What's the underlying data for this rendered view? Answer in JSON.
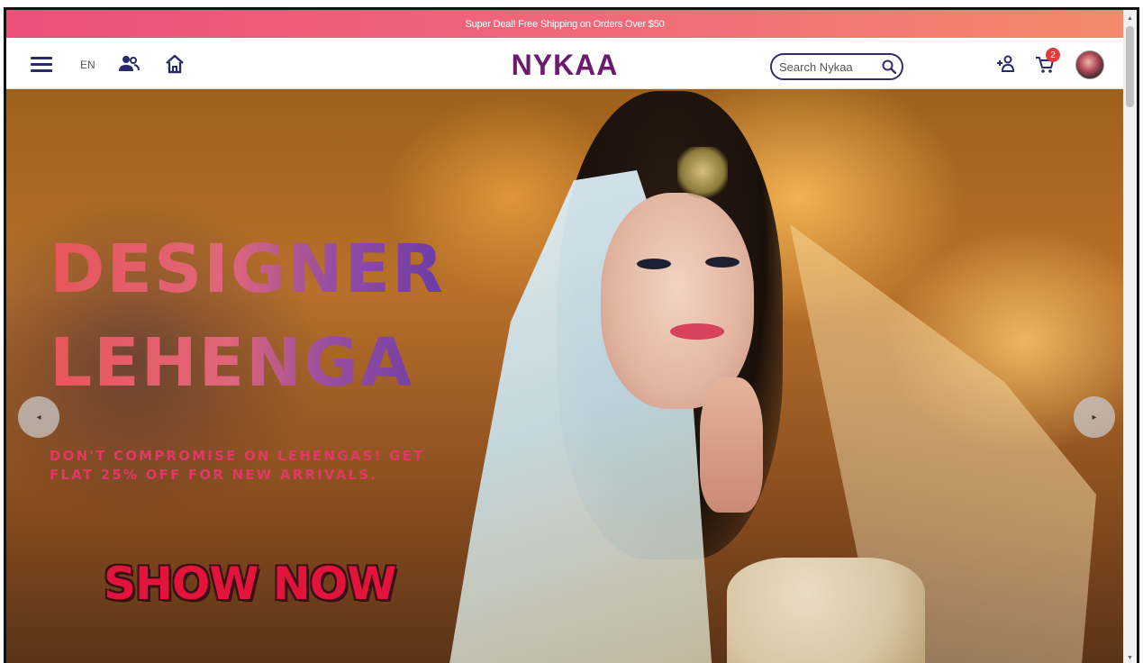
{
  "promo": {
    "text": "Super Deal! Free Shipping on Orders Over $50"
  },
  "header": {
    "language": "EN",
    "logo": "NYKAA",
    "search_placeholder": "Search Nykaa",
    "cart_count": "2"
  },
  "hero": {
    "title_line1": "DESIGNER",
    "title_line2": "LEHENGA",
    "subtitle": "DON'T COMPROMISE ON LEHENGAS! GET FLAT 25% OFF FOR NEW ARRIVALS.",
    "cta_label": "SHOW NOW"
  },
  "carousel": {
    "prev_glyph": "◂",
    "next_glyph": "▸"
  },
  "icons": [
    "menu-icon",
    "users-icon",
    "home-icon",
    "search-icon",
    "add-user-icon",
    "cart-icon",
    "avatar"
  ],
  "colors": {
    "brand": "#6b1a6e",
    "promo_start": "#ec4f7a",
    "promo_end": "#f38a6b",
    "cta": "#e2143c",
    "subtitle": "#e03a64",
    "badge": "#e53b3b"
  }
}
